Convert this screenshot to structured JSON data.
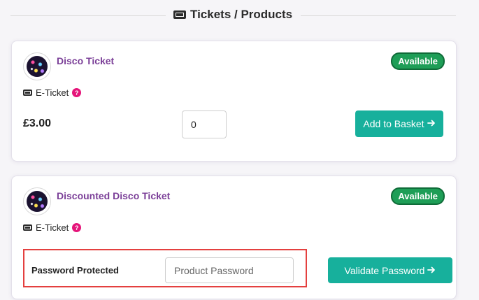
{
  "section": {
    "title": "Tickets / Products",
    "icon": "ticket-icon"
  },
  "products": [
    {
      "name": "Disco Ticket",
      "status": "Available",
      "type_label": "E-Ticket",
      "help_glyph": "?",
      "price": "£3.00",
      "quantity": "0",
      "action_label": "Add to Basket",
      "action_icon": "arrow-right-icon"
    },
    {
      "name": "Discounted Disco Ticket",
      "status": "Available",
      "type_label": "E-Ticket",
      "help_glyph": "?",
      "password_label": "Password Protected",
      "password_value": "",
      "password_placeholder": "Product Password",
      "action_label": "Validate Password",
      "action_icon": "arrow-right-icon"
    }
  ],
  "colors": {
    "accent_button": "#17b09c",
    "status_green": "#1e9e57",
    "product_name": "#7b3f98",
    "help_pink": "#e5157a",
    "highlight_red": "#e4403f"
  }
}
